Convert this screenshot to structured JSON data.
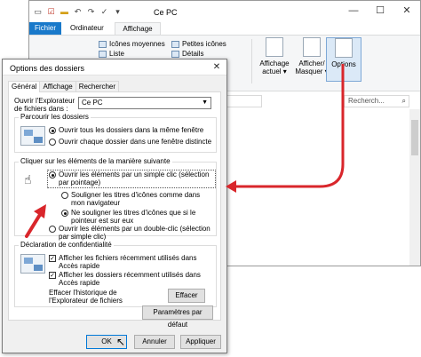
{
  "explorer": {
    "title": "Ce PC",
    "tabs": {
      "fichier": "Fichier",
      "ordinateur": "Ordinateur",
      "affichage": "Affichage"
    },
    "ribbon": {
      "layout_items": [
        "Icônes moyennes",
        "Liste",
        "Détails"
      ],
      "layout_items2": [
        "Petites icônes",
        "Détails"
      ],
      "affichage_actuel": "Affichage actuel ▾",
      "afficher_masquer": "Afficher/ Masquer ▾",
      "options": "Options"
    },
    "search_placeholder": "Recherch..."
  },
  "dialog": {
    "title": "Options des dossiers",
    "tabs": [
      "Général",
      "Affichage",
      "Rechercher"
    ],
    "open_explorer_label": "Ouvrir l'Explorateur de fichiers dans :",
    "open_explorer_value": "Ce PC",
    "browse_group": {
      "legend": "Parcourir les dossiers",
      "option1": "Ouvrir tous les dossiers dans la même fenêtre",
      "option2": "Ouvrir chaque dossier dans une fenêtre distincte"
    },
    "click_group": {
      "legend": "Cliquer sur les éléments de la manière suivante",
      "option_single": "Ouvrir les éléments par un simple clic (sélection par pointage)",
      "sub_option1": "Souligner les titres d'icônes comme dans mon navigateur",
      "sub_option2": "Ne souligner les titres d'icônes que si le pointeur est sur eux",
      "option_double": "Ouvrir les éléments par un double-clic (sélection par simple clic)"
    },
    "privacy_group": {
      "legend": "Déclaration de confidentialité",
      "check1": "Afficher les fichiers récemment utilisés dans Accès rapide",
      "check2": "Afficher les dossiers récemment utilisés dans Accès rapide",
      "clear_label": "Effacer l'historique de l'Explorateur de fichiers",
      "clear_button": "Effacer"
    },
    "defaults_button": "Paramètres par défaut",
    "ok": "OK",
    "cancel": "Annuler",
    "apply": "Appliquer"
  }
}
